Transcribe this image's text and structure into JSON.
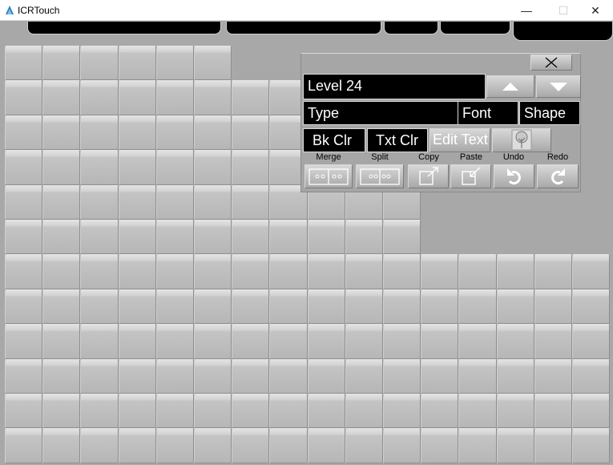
{
  "window": {
    "title": "ICRTouch",
    "minimize_glyph": "—",
    "maximize_glyph": "☐",
    "close_glyph": "✕"
  },
  "editor": {
    "level_label": "Level 24",
    "type_label": "Type",
    "font_label": "Font",
    "shape_label": "Shape",
    "bk_clr_label": "Bk Clr",
    "txt_clr_label": "Txt Clr",
    "edit_text_label": "Edit Text",
    "merge_label": "Merge",
    "split_label": "Split",
    "copy_label": "Copy",
    "paste_label": "Paste",
    "undo_label": "Undo",
    "redo_label": "Redo"
  },
  "icons": {
    "up": "up-arrow-icon",
    "down": "down-arrow-icon",
    "close": "close-icon",
    "tree": "tree-image-icon",
    "merge": "merge-icon",
    "split": "split-icon",
    "copy": "copy-icon",
    "paste": "paste-icon",
    "undo": "undo-icon",
    "redo": "redo-icon"
  },
  "colors": {
    "background": "#a8a8a8",
    "button_black": "#000000",
    "tile_light": "#d2d2d2",
    "tile_dark": "#b6b6b6"
  }
}
